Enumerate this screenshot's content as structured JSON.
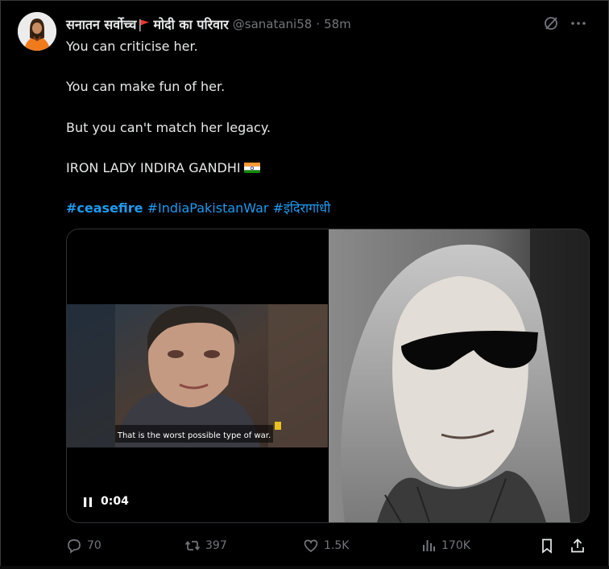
{
  "author": {
    "name": "सनातन सर्वोच्च",
    "name_suffix": "मोदी का परिवार",
    "handle": "@sanatani58",
    "separator": "·",
    "time": "58m"
  },
  "tweet": {
    "line1": "You can criticise her.",
    "line2": "You can make fun of her.",
    "line3": "But you can't match her legacy.",
    "line4": "IRON LADY INDIRA GANDHI",
    "hashtags": [
      "#ceasefire",
      "#IndiaPakistanWar",
      "#इंदिरागांधी"
    ]
  },
  "media": {
    "subtitle": "That is the worst possible type of war.",
    "timestamp": "0:04"
  },
  "actions": {
    "replies": "70",
    "reposts": "397",
    "likes": "1.5K",
    "views": "170K"
  },
  "colors": {
    "background": "#000000",
    "text": "#e7e9ea",
    "muted": "#71767b",
    "link": "#1d9bf0"
  }
}
